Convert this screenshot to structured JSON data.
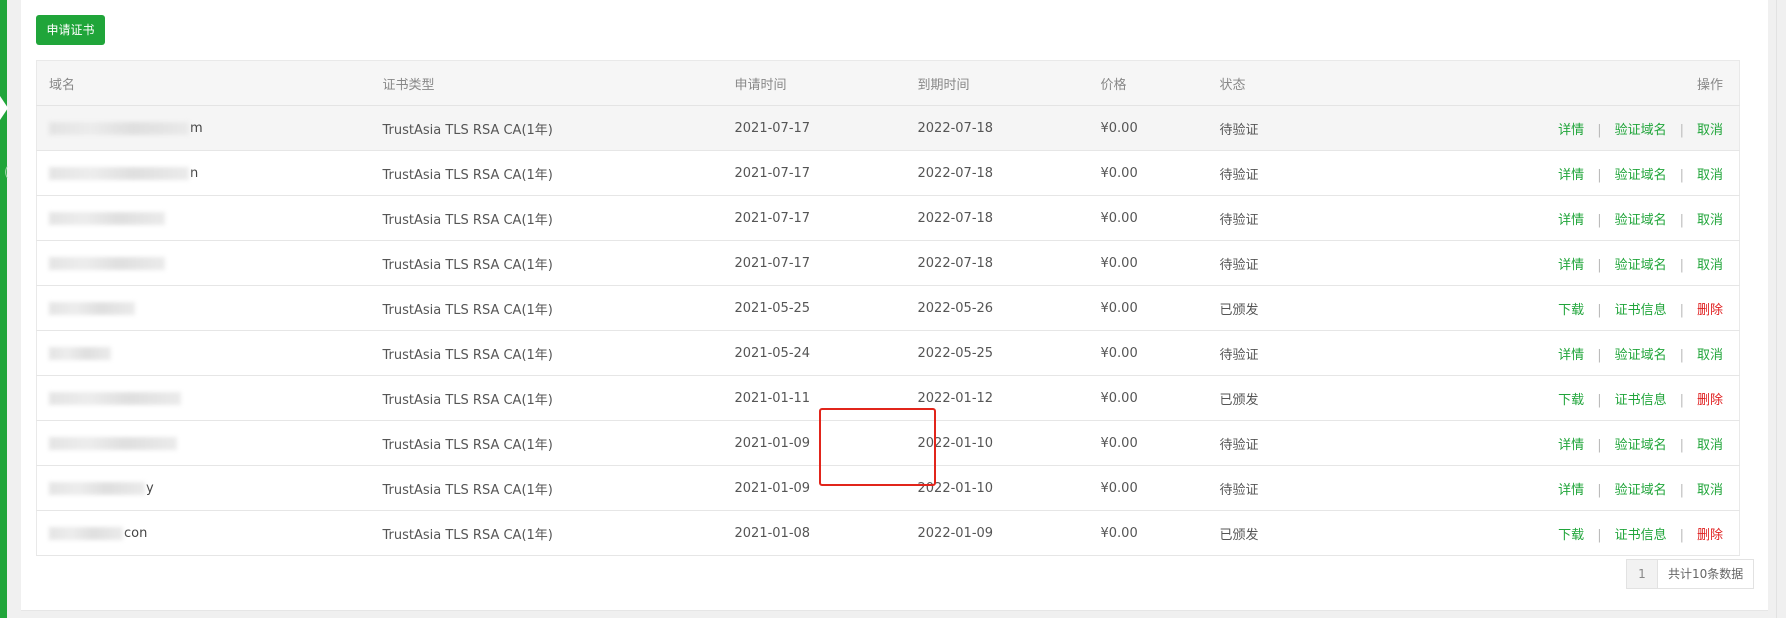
{
  "toolbar": {
    "apply_label": "申请证书"
  },
  "table": {
    "headers": [
      "域名",
      "证书类型",
      "申请时间",
      "到期时间",
      "价格",
      "状态",
      "操作"
    ],
    "rows": [
      {
        "domain_tail": "m",
        "type": "TrustAsia TLS RSA CA(1年)",
        "applied": "2021-07-17",
        "expires": "2022-07-18",
        "price": "¥0.00",
        "status": "待验证",
        "ops": [
          "详情",
          "验证域名",
          "取消"
        ]
      },
      {
        "domain_tail": "n",
        "type": "TrustAsia TLS RSA CA(1年)",
        "applied": "2021-07-17",
        "expires": "2022-07-18",
        "price": "¥0.00",
        "status": "待验证",
        "ops": [
          "详情",
          "验证域名",
          "取消"
        ]
      },
      {
        "domain_tail": "",
        "type": "TrustAsia TLS RSA CA(1年)",
        "applied": "2021-07-17",
        "expires": "2022-07-18",
        "price": "¥0.00",
        "status": "待验证",
        "ops": [
          "详情",
          "验证域名",
          "取消"
        ]
      },
      {
        "domain_tail": "",
        "type": "TrustAsia TLS RSA CA(1年)",
        "applied": "2021-07-17",
        "expires": "2022-07-18",
        "price": "¥0.00",
        "status": "待验证",
        "ops": [
          "详情",
          "验证域名",
          "取消"
        ]
      },
      {
        "domain_tail": "",
        "type": "TrustAsia TLS RSA CA(1年)",
        "applied": "2021-05-25",
        "expires": "2022-05-26",
        "price": "¥0.00",
        "status": "已颁发",
        "ops": [
          "下载",
          "证书信息",
          "删除"
        ]
      },
      {
        "domain_tail": "",
        "type": "TrustAsia TLS RSA CA(1年)",
        "applied": "2021-05-24",
        "expires": "2022-05-25",
        "price": "¥0.00",
        "status": "待验证",
        "ops": [
          "详情",
          "验证域名",
          "取消"
        ]
      },
      {
        "domain_tail": "",
        "type": "TrustAsia TLS RSA CA(1年)",
        "applied": "2021-01-11",
        "expires": "2022-01-12",
        "price": "¥0.00",
        "status": "已颁发",
        "ops": [
          "下载",
          "证书信息",
          "删除"
        ]
      },
      {
        "domain_tail": "",
        "type": "TrustAsia TLS RSA CA(1年)",
        "applied": "2021-01-09",
        "expires": "2022-01-10",
        "price": "¥0.00",
        "status": "待验证",
        "ops": [
          "详情",
          "验证域名",
          "取消"
        ]
      },
      {
        "domain_tail": "y",
        "type": "TrustAsia TLS RSA CA(1年)",
        "applied": "2021-01-09",
        "expires": "2022-01-10",
        "price": "¥0.00",
        "status": "待验证",
        "ops": [
          "详情",
          "验证域名",
          "取消"
        ]
      },
      {
        "domain_tail": "con",
        "type": "TrustAsia TLS RSA CA(1年)",
        "applied": "2021-01-08",
        "expires": "2022-01-09",
        "price": "¥0.00",
        "status": "已颁发",
        "ops": [
          "下载",
          "证书信息",
          "删除"
        ]
      }
    ]
  },
  "pagination": {
    "current_page": "1",
    "total_label": "共计10条数据"
  },
  "colors": {
    "accent": "#20a53a",
    "danger": "#e02020",
    "highlight": "#e1251b"
  }
}
